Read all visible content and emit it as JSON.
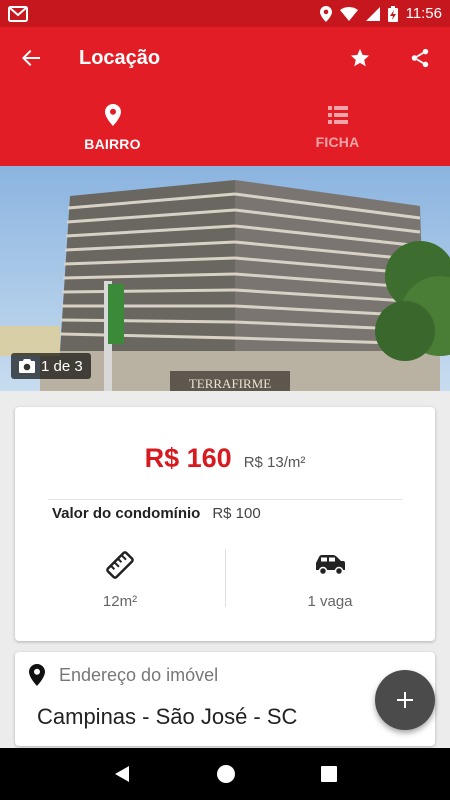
{
  "status_bar": {
    "time": "11:56"
  },
  "app_bar": {
    "title": "Locação"
  },
  "tabs": [
    {
      "label": "BAIRRO",
      "icon": "location-pin-icon",
      "active": true
    },
    {
      "label": "FICHA",
      "icon": "list-icon",
      "active": false
    }
  ],
  "photo": {
    "counter": "1 de 3",
    "building_sign": "TERRAFIRME"
  },
  "price": {
    "rent": "R$ 160",
    "per_sqm": "R$ 13/m²",
    "condo_label": "Valor do condomínio",
    "condo_value": "R$ 100"
  },
  "features": {
    "area": "12m²",
    "parking": "1 vaga"
  },
  "address": {
    "label": "Endereço do imóvel",
    "value": "Campinas - São José - SC"
  },
  "colors": {
    "primary": "#e21d25",
    "status_bar": "#c6161e",
    "price": "#d71920",
    "fab": "#4b4b4b"
  }
}
